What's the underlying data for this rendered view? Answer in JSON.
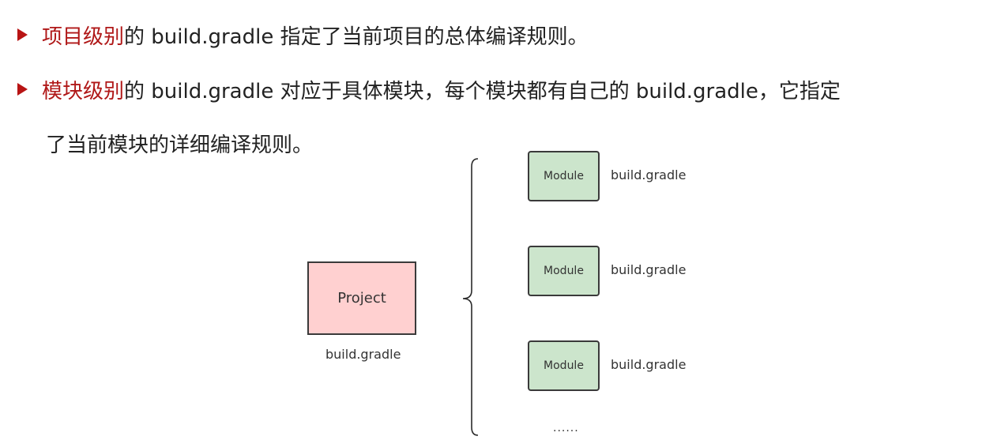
{
  "bullets": [
    {
      "highlight": "项目级别",
      "text": "的 build.gradle 指定了当前项目的总体编译规则。"
    },
    {
      "highlight": "模块级别",
      "text": "的 build.gradle 对应于具体模块，每个模块都有自己的 build.gradle，它指定",
      "continuation": "了当前模块的详细编译规则。"
    }
  ],
  "diagram": {
    "project": {
      "label": "Project",
      "file": "build.gradle"
    },
    "modules": [
      {
        "label": "Module",
        "file": "build.gradle"
      },
      {
        "label": "Module",
        "file": "build.gradle"
      },
      {
        "label": "Module",
        "file": "build.gradle"
      }
    ],
    "more": "......"
  },
  "colors": {
    "highlight": "#b01818",
    "project_fill": "#ffd0d0",
    "module_fill": "#cce5cc"
  }
}
